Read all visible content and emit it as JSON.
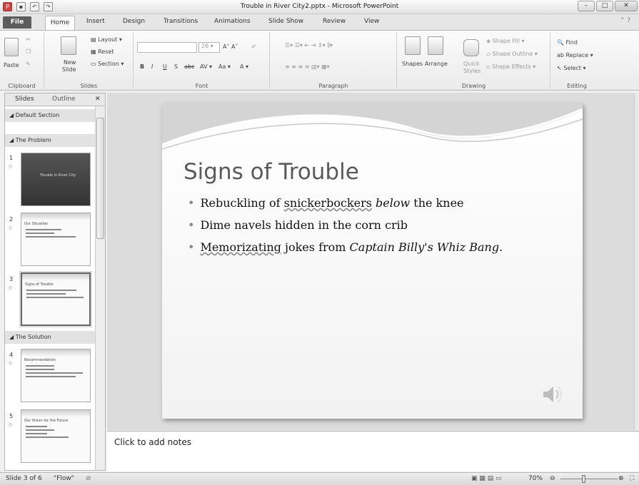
{
  "window": {
    "title": "Trouble in River City2.pptx - Microsoft PowerPoint",
    "qat_icons": [
      "powerpoint-icon",
      "save-icon",
      "undo-icon",
      "redo-icon"
    ]
  },
  "tabs": [
    "File",
    "Home",
    "Insert",
    "Design",
    "Transitions",
    "Animations",
    "Slide Show",
    "Review",
    "View"
  ],
  "ribbon": {
    "clipboard": {
      "label": "Clipboard",
      "paste": "Paste"
    },
    "slides": {
      "label": "Slides",
      "new_slide_1": "New",
      "new_slide_2": "Slide",
      "layout": "Layout",
      "reset": "Reset",
      "section": "Section"
    },
    "font": {
      "label": "Font",
      "size": "26"
    },
    "paragraph": {
      "label": "Paragraph"
    },
    "drawing": {
      "label": "Drawing",
      "shapes": "Shapes",
      "arrange": "Arrange",
      "quick_styles_1": "Quick",
      "quick_styles_2": "Styles",
      "shape_fill": "Shape Fill",
      "shape_outline": "Shape Outline",
      "shape_effects": "Shape Effects"
    },
    "editing": {
      "label": "Editing",
      "find": "Find",
      "replace": "Replace",
      "select": "Select"
    }
  },
  "panel": {
    "tab_slides": "Slides",
    "tab_outline": "Outline",
    "sections": [
      "Default Section",
      "The Problem",
      "The Solution"
    ],
    "thumbnails": [
      {
        "num": "1",
        "title": "Trouble in River City",
        "dark": true
      },
      {
        "num": "2",
        "title": "Our Situation"
      },
      {
        "num": "3",
        "title": "Signs of Trouble",
        "selected": true
      },
      {
        "num": "4",
        "title": "Recommendation"
      },
      {
        "num": "5",
        "title": "Our Vision for the Future"
      }
    ]
  },
  "slide": {
    "title": "Signs of Trouble",
    "bullet1_a": "Rebuckling of ",
    "bullet1_b": "snickerbockers",
    "bullet1_c": " ",
    "bullet1_d": "below",
    "bullet1_e": " the knee",
    "bullet2": "Dime navels hidden in the corn crib",
    "bullet3_a": "Memorizating",
    "bullet3_b": " jokes from ",
    "bullet3_c": "Captain Billy's Whiz Bang",
    "bullet3_d": "."
  },
  "notes": {
    "placeholder": "Click to add notes"
  },
  "status": {
    "slide_of": "Slide 3 of 6",
    "theme": "\"Flow\"",
    "zoom": "70%"
  }
}
